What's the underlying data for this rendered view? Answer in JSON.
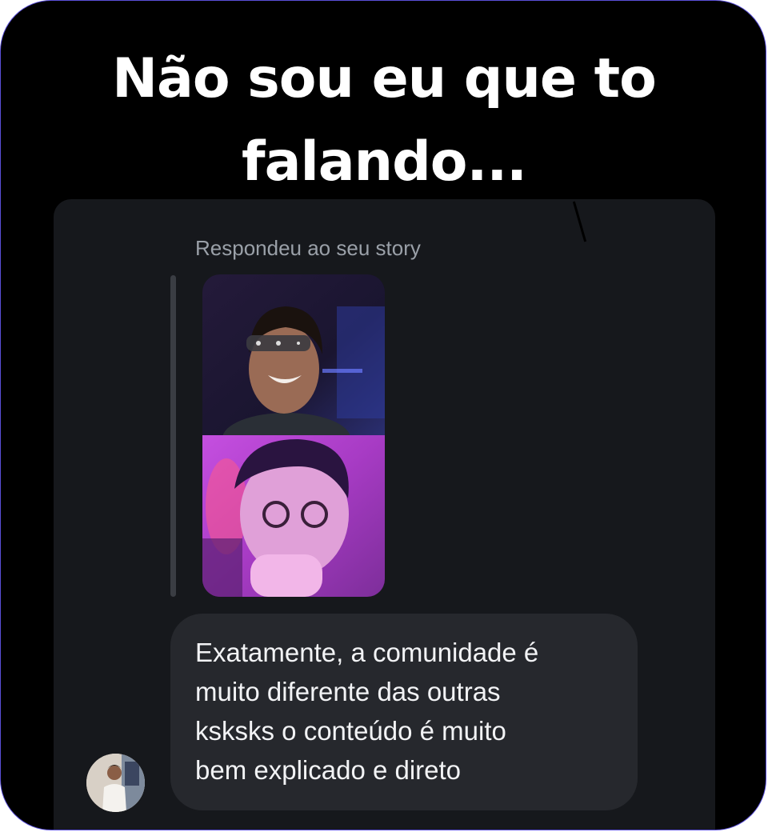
{
  "headline": {
    "line1": "Não sou eu que to",
    "line2": "falando..."
  },
  "chat": {
    "reply_label": "Respondeu ao seu story",
    "story": {
      "top_panel_color": "#1c1530",
      "bottom_panel_color": "#b13fc9"
    },
    "message": {
      "lines": [
        "Exatamente, a comunidade é",
        "muito diferente das outras",
        "ksksks o conteúdo é muito",
        "bem explicado e direto"
      ]
    }
  },
  "colors": {
    "background": "#000000",
    "panel": "#16181c",
    "bubble": "#26282d",
    "frame_border": "#5a4fd8"
  }
}
